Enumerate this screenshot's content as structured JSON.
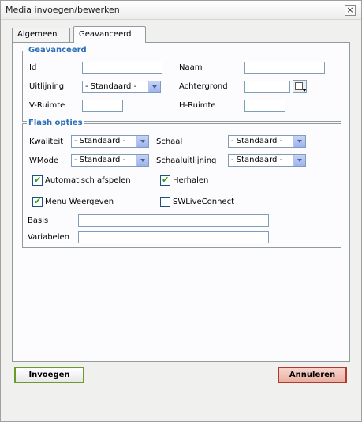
{
  "window": {
    "title": "Media invoegen/bewerken",
    "close": "×"
  },
  "tabs": [
    {
      "label": "Algemeen",
      "active": false
    },
    {
      "label": "Geavanceerd",
      "active": true
    }
  ],
  "advanced": {
    "legend": "Geavanceerd",
    "id_label": "Id",
    "id_value": "",
    "name_label": "Naam",
    "name_value": "",
    "align_label": "Uitlijning",
    "align_value": "- Standaard -",
    "background_label": "Achtergrond",
    "background_value": "",
    "vspace_label": "V-Ruimte",
    "vspace_value": "",
    "hspace_label": "H-Ruimte",
    "hspace_value": ""
  },
  "flash": {
    "legend": "Flash opties",
    "quality_label": "Kwaliteit",
    "quality_value": "- Standaard -",
    "scale_label": "Schaal",
    "scale_value": "- Standaard -",
    "wmode_label": "WMode",
    "wmode_value": "- Standaard -",
    "salign_label": "Schaaluitlijning",
    "salign_value": "- Standaard -",
    "autoplay_label": "Automatisch afspelen",
    "autoplay_checked": true,
    "loop_label": "Herhalen",
    "loop_checked": true,
    "menu_label": "Menu Weergeven",
    "menu_checked": true,
    "swlive_label": "SWLiveConnect",
    "swlive_checked": false,
    "base_label": "Basis",
    "base_value": "",
    "flashvars_label": "Variabelen",
    "flashvars_value": ""
  },
  "footer": {
    "insert_label": "Invoegen",
    "cancel_label": "Annuleren"
  },
  "colors": {
    "legend": "#2b6fb6",
    "check": "#21a121",
    "insert_border": "#6b9b2c",
    "cancel_border": "#b03a2e"
  },
  "icons": {
    "close": "close-icon",
    "color_picker": "color-picker-icon",
    "dropdown": "chevron-down-icon",
    "check": "checkmark-icon"
  }
}
